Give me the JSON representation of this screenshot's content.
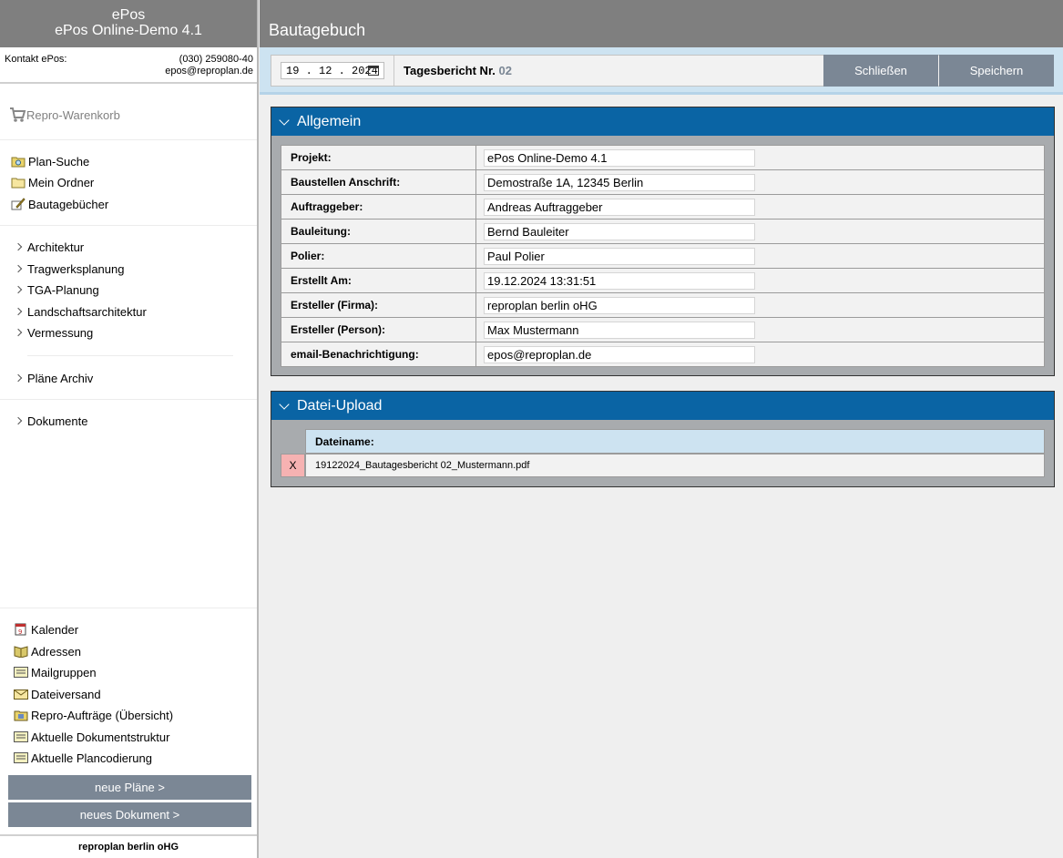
{
  "brand": {
    "line1": "ePos",
    "line2": "ePos Online-Demo 4.1"
  },
  "contact": {
    "label": "Kontakt ePos:",
    "phone": "(030) 259080-40",
    "email": "epos@reproplan.de"
  },
  "cart": {
    "label": "Repro-Warenkorb",
    "icon": "cart-icon"
  },
  "nav_main": [
    {
      "label": "Plan-Suche",
      "icon": "search-folder-icon"
    },
    {
      "label": "Mein Ordner",
      "icon": "folder-icon"
    },
    {
      "label": "Bautagebücher",
      "icon": "edit-pencil-icon"
    }
  ],
  "nav_disciplines": [
    "Architektur",
    "Tragwerksplanung",
    "TGA-Planung",
    "Landschaftsarchitektur",
    "Vermessung"
  ],
  "nav_archive": "Pläne Archiv",
  "nav_documents": "Dokumente",
  "nav_tools": [
    {
      "label": "Kalender",
      "icon": "calendar-icon"
    },
    {
      "label": "Adressen",
      "icon": "address-book-icon"
    },
    {
      "label": "Mailgruppen",
      "icon": "list-icon"
    },
    {
      "label": "Dateiversand",
      "icon": "envelope-icon"
    },
    {
      "label": "Repro-Aufträge (Übersicht)",
      "icon": "orders-icon"
    },
    {
      "label": "Aktuelle Dokumentstruktur",
      "icon": "list-icon"
    },
    {
      "label": "Aktuelle Plancodierung",
      "icon": "list-icon"
    }
  ],
  "buttons": {
    "new_plans": "neue Pläne >",
    "new_document": "neues Dokument >"
  },
  "footer": "reproplan berlin oHG",
  "header": {
    "title": "Bautagebuch"
  },
  "toolbar": {
    "date": "19 . 12 . 2024",
    "report_label": "Tagesbericht Nr.",
    "report_number": "02",
    "close_label": "Schließen",
    "save_label": "Speichern"
  },
  "general": {
    "title": "Allgemein",
    "fields": [
      {
        "label": "Projekt:",
        "value": "ePos Online-Demo 4.1"
      },
      {
        "label": "Baustellen Anschrift:",
        "value": "Demostraße 1A, 12345 Berlin"
      },
      {
        "label": "Auftraggeber:",
        "value": "Andreas Auftraggeber"
      },
      {
        "label": "Bauleitung:",
        "value": "Bernd Bauleiter"
      },
      {
        "label": "Polier:",
        "value": "Paul Polier"
      },
      {
        "label": "Erstellt Am:",
        "value": "19.12.2024 13:31:51"
      },
      {
        "label": "Ersteller (Firma):",
        "value": "reproplan berlin oHG"
      },
      {
        "label": "Ersteller (Person):",
        "value": "Max Mustermann"
      },
      {
        "label": "email-Benachrichtigung:",
        "value": "epos@reproplan.de"
      }
    ]
  },
  "upload": {
    "title": "Datei-Upload",
    "column": "Dateiname:",
    "delete_label": "X",
    "files": [
      "19122024_Bautagesbericht 02_Mustermann.pdf"
    ]
  },
  "colors": {
    "header_gray": "#7f7f7f",
    "panel_blue": "#0a64a4",
    "button_gray": "#7b8795",
    "delete_red": "#f6b2b2",
    "light_blue": "#cde3f1"
  }
}
